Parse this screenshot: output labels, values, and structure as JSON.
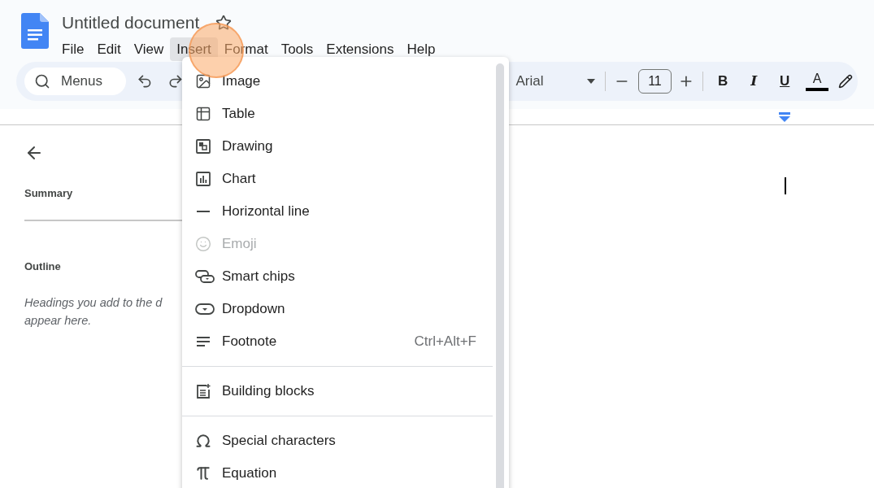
{
  "document": {
    "title": "Untitled document",
    "starred": false
  },
  "menubar": [
    {
      "label": "File",
      "selected": false
    },
    {
      "label": "Edit",
      "selected": false
    },
    {
      "label": "View",
      "selected": false
    },
    {
      "label": "Insert",
      "selected": true
    },
    {
      "label": "Format",
      "selected": false
    },
    {
      "label": "Tools",
      "selected": false
    },
    {
      "label": "Extensions",
      "selected": false
    },
    {
      "label": "Help",
      "selected": false
    }
  ],
  "toolbar": {
    "search": {
      "placeholder": "Menus"
    },
    "font": "Arial",
    "font_size": "11",
    "format_buttons": [
      {
        "label": "B",
        "kind": "bold"
      },
      {
        "label": "I",
        "kind": "italic"
      },
      {
        "label": "U",
        "kind": "underline"
      },
      {
        "label": "A",
        "kind": "color",
        "color": "#000000"
      }
    ]
  },
  "outline_panel": {
    "summary_heading": "Summary",
    "outline_heading": "Outline",
    "hint_lines": [
      "Headings you add to the d",
      "appear here."
    ]
  },
  "insert_menu": [
    {
      "kind": "item",
      "label": "Image",
      "disabled": false
    },
    {
      "kind": "item",
      "label": "Table",
      "disabled": false
    },
    {
      "kind": "item",
      "label": "Drawing",
      "disabled": false
    },
    {
      "kind": "item",
      "label": "Chart",
      "disabled": false
    },
    {
      "kind": "item",
      "label": "Horizontal line",
      "disabled": false
    },
    {
      "kind": "item",
      "label": "Emoji",
      "disabled": true
    },
    {
      "kind": "item",
      "label": "Smart chips",
      "disabled": false
    },
    {
      "kind": "item",
      "label": "Dropdown",
      "disabled": false
    },
    {
      "kind": "item",
      "label": "Footnote",
      "disabled": false,
      "shortcut": "Ctrl+Alt+F"
    },
    {
      "kind": "separator"
    },
    {
      "kind": "item",
      "label": "Building blocks",
      "disabled": false
    },
    {
      "kind": "separator"
    },
    {
      "kind": "item",
      "label": "Special characters",
      "disabled": false
    },
    {
      "kind": "item",
      "label": "Equation",
      "disabled": false
    }
  ]
}
